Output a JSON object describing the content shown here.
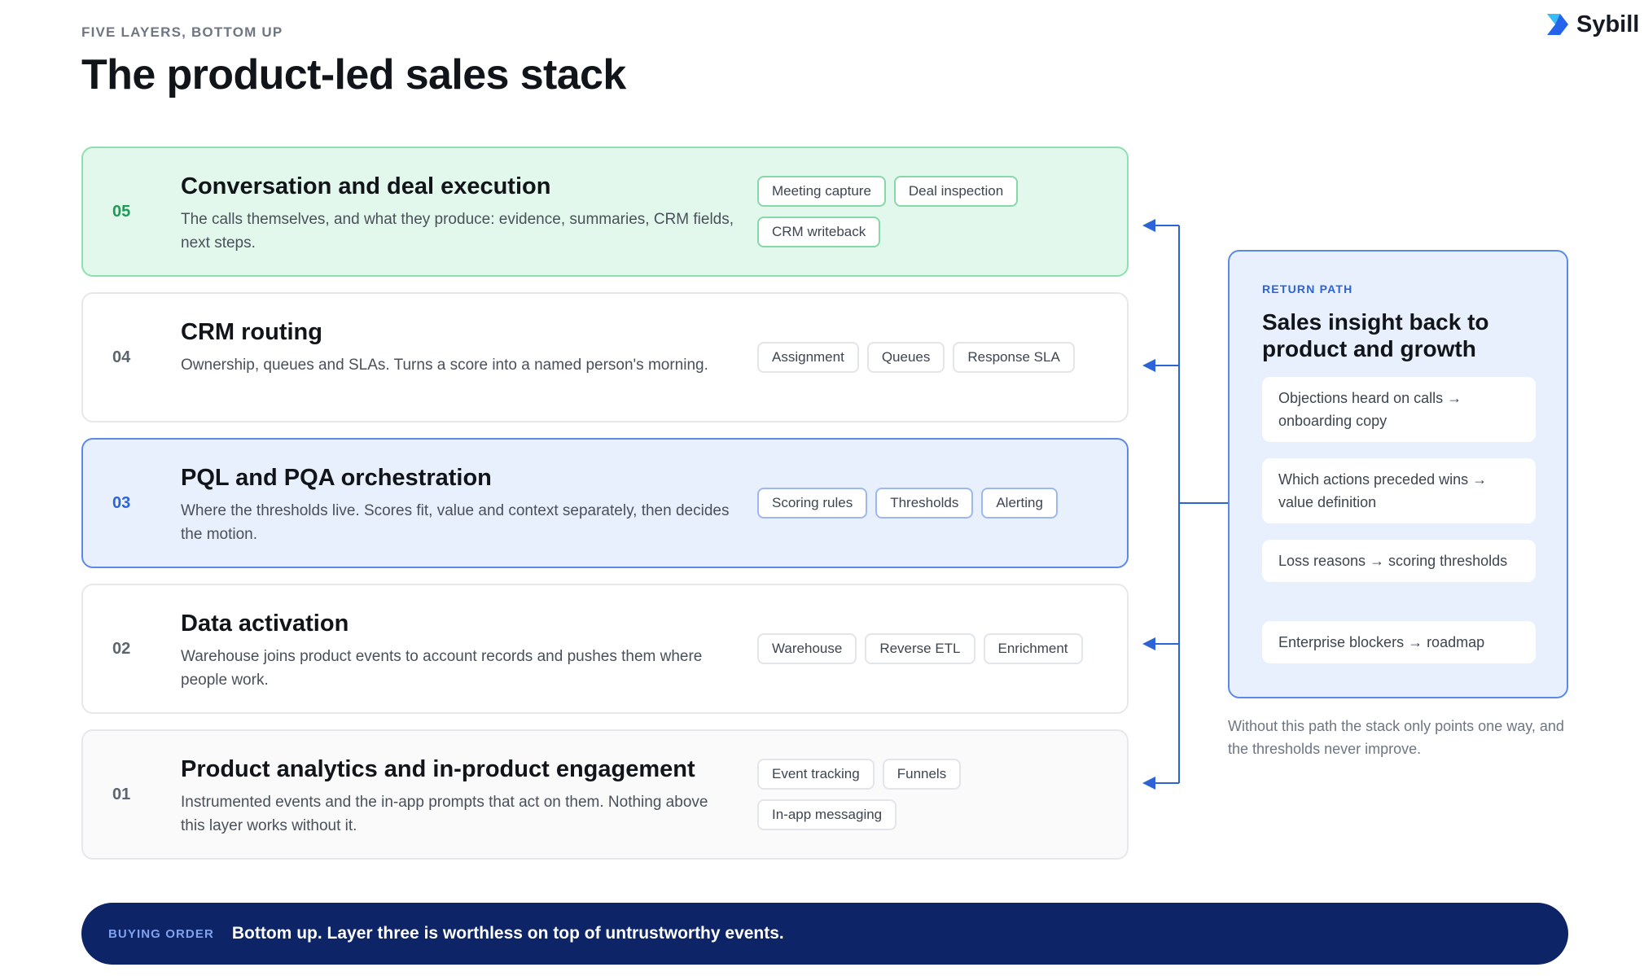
{
  "header": {
    "eyebrow": "FIVE LAYERS, BOTTOM UP",
    "title": "The product-led sales stack",
    "brand": "Sybill",
    "brand_icon": "sybill-logo-icon"
  },
  "layers": [
    {
      "number": "05",
      "title": "Conversation and deal execution",
      "description": "The calls themselves, and what they produce: evidence, summaries, CRM fields, next steps.",
      "tags": [
        "Meeting capture",
        "Deal inspection",
        "CRM writeback"
      ],
      "state": "highlighted-green"
    },
    {
      "number": "04",
      "title": "CRM routing",
      "description": "Ownership, queues and SLAs. Turns a score into a named person's morning.",
      "tags": [
        "Assignment",
        "Queues",
        "Response SLA"
      ],
      "state": "default"
    },
    {
      "number": "03",
      "title": "PQL and PQA orchestration",
      "description": "Where the thresholds live. Scores fit, value and context separately, then decides the motion.",
      "tags": [
        "Scoring rules",
        "Thresholds",
        "Alerting"
      ],
      "state": "highlighted-blue"
    },
    {
      "number": "02",
      "title": "Data activation",
      "description": "Warehouse joins product events to account records and pushes them where people work.",
      "tags": [
        "Warehouse",
        "Reverse ETL",
        "Enrichment"
      ],
      "state": "default"
    },
    {
      "number": "01",
      "title": "Product analytics and in-product engagement",
      "description": "Instrumented events and the in-app prompts that act on them. Nothing above this layer works without it.",
      "tags": [
        "Event tracking",
        "Funnels",
        "In-app messaging"
      ],
      "state": "muted"
    }
  ],
  "return_path": {
    "eyebrow": "RETURN PATH",
    "title": "Sales insight back to product and growth",
    "items": [
      "Objections heard on calls → onboarding copy",
      "Which actions preceded wins → value definition",
      "Loss reasons → scoring thresholds",
      "Enterprise blockers → roadmap"
    ],
    "note": "Without this path the stack only points one way, and the thresholds never improve."
  },
  "buying_order": {
    "label": "BUYING ORDER",
    "text": "Bottom up. Layer three is worthless on top of untrustworthy events."
  },
  "colors": {
    "accent_blue": "#2c63d6",
    "accent_green": "#1f9a58",
    "navy": "#0d2466"
  }
}
